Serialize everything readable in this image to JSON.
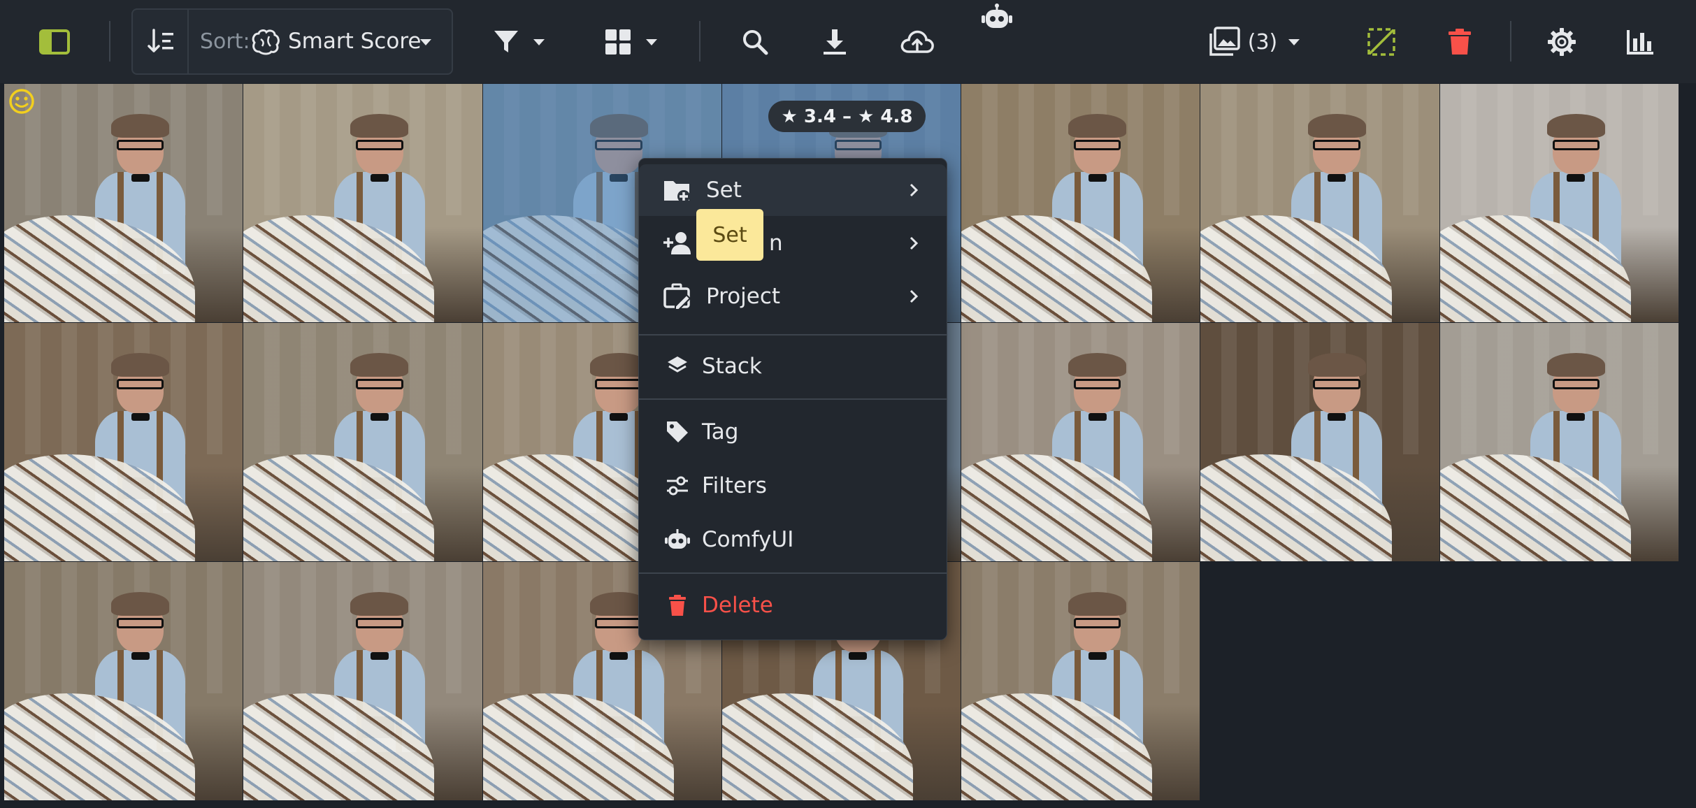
{
  "toolbar": {
    "sort_label": "Sort:",
    "sort_value": "Smart Score",
    "media_count": "(3)",
    "icons": [
      "sidebar-toggle-icon",
      "sort-direction-icon",
      "brain-icon",
      "filter-icon",
      "grid-layout-icon",
      "search-icon",
      "download-icon",
      "cloud-upload-icon",
      "robot-icon",
      "images-icon",
      "deselect-icon",
      "trash-icon",
      "gear-icon",
      "bar-chart-icon"
    ]
  },
  "overlay": {
    "rating_range": "★ 3.4 – ★ 4.8"
  },
  "context_menu": {
    "items": [
      {
        "label": "Set",
        "icon": "folder-plus-icon",
        "submenu": true
      },
      {
        "label": "Person",
        "icon": "user-plus-icon",
        "submenu": true
      },
      {
        "label": "Project",
        "icon": "briefcase-edit-icon",
        "submenu": true
      },
      {
        "label": "Stack",
        "icon": "layers-icon",
        "submenu": false
      },
      {
        "label": "Tag",
        "icon": "tag-icon",
        "submenu": false
      },
      {
        "label": "Filters",
        "icon": "sliders-icon",
        "submenu": false
      },
      {
        "label": "ComfyUI",
        "icon": "robot-icon",
        "submenu": false
      },
      {
        "label": "Delete",
        "icon": "trash-icon",
        "submenu": false
      }
    ],
    "visible_person_fragment": "n",
    "tooltip": "Set"
  },
  "colors": {
    "toolbar_bg": "#22272e",
    "page_bg": "#1c2128",
    "accent_green": "#a3be3b",
    "danger_red": "#f85149",
    "tooltip_bg": "#fbe89a"
  }
}
